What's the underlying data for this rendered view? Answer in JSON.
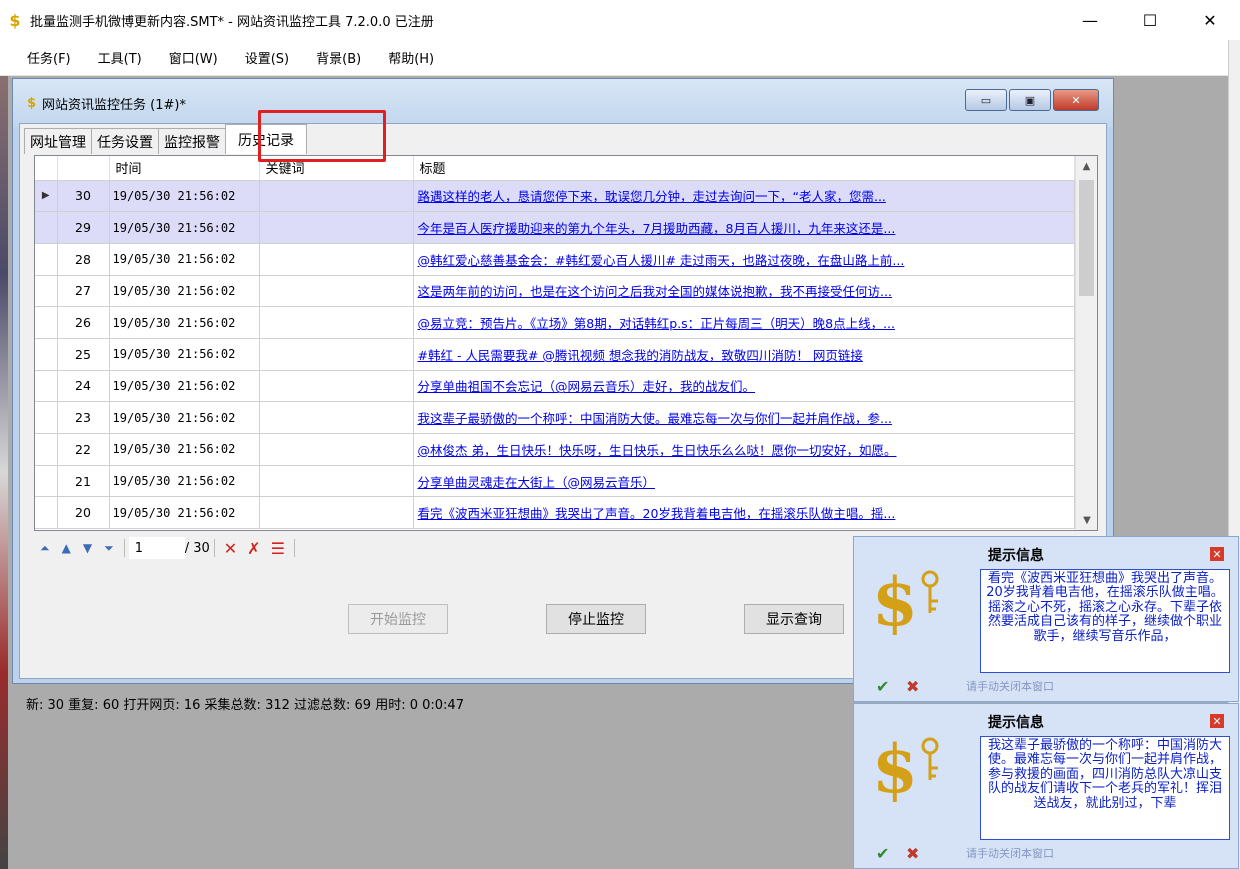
{
  "window": {
    "title": "批量监测手机微博更新内容.SMT* - 网站资讯监控工具 7.2.0.0 已注册",
    "min": "—",
    "max": "☐",
    "close": "✕"
  },
  "menu": [
    "任务(F)",
    "工具(T)",
    "窗口(W)",
    "设置(S)",
    "背景(B)",
    "帮助(H)"
  ],
  "child": {
    "title": "网站资讯监控任务 (1#)*",
    "tabs": [
      "网址管理",
      "任务设置",
      "监控报警",
      "历史记录"
    ],
    "active_tab": "历史记录"
  },
  "grid": {
    "columns": [
      "时间",
      "关键词",
      "标题"
    ],
    "rows": [
      {
        "no": "30",
        "time": "19/05/30 21:56:02",
        "keyword": "",
        "title": "路遇这样的老人，恳请您停下来，耽误您几分钟，走过去询问一下，“老人家，您需..."
      },
      {
        "no": "29",
        "time": "19/05/30 21:56:02",
        "keyword": "",
        "title": "今年是百人医疗援助迎来的第九个年头，7月援助西藏，8月百人援川，九年来这还是..."
      },
      {
        "no": "28",
        "time": "19/05/30 21:56:02",
        "keyword": "",
        "title": "@韩红爱心慈善基金会：#韩红爱心百人援川# 走过雨天，也路过夜晚，在盘山路上前..."
      },
      {
        "no": "27",
        "time": "19/05/30 21:56:02",
        "keyword": "",
        "title": "这是两年前的访问，也是在这个访问之后我对全国的媒体说抱歉，我不再接受任何访..."
      },
      {
        "no": "26",
        "time": "19/05/30 21:56:02",
        "keyword": "",
        "title": "@易立竞：预告片。《立场》第8期，对话韩红p.s：正片每周三（明天）晚8点上线，..."
      },
      {
        "no": "25",
        "time": "19/05/30 21:56:02",
        "keyword": "",
        "title": "#韩红 - 人民需要我# @腾讯视频 想念我的消防战友，致敬四川消防！ 网页链接"
      },
      {
        "no": "24",
        "time": "19/05/30 21:56:02",
        "keyword": "",
        "title": "分享单曲祖国不会忘记（@网易云音乐）走好，我的战友们。"
      },
      {
        "no": "23",
        "time": "19/05/30 21:56:02",
        "keyword": "",
        "title": "我这辈子最骄傲的一个称呼：中国消防大使。最难忘每一次与你们一起并肩作战，参..."
      },
      {
        "no": "22",
        "time": "19/05/30 21:56:02",
        "keyword": "",
        "title": "@林俊杰 弟，生日快乐！快乐呀，生日快乐，生日快乐么么哒！愿你一切安好，如愿。"
      },
      {
        "no": "21",
        "time": "19/05/30 21:56:02",
        "keyword": "",
        "title": "分享单曲灵魂走在大街上（@网易云音乐）"
      },
      {
        "no": "20",
        "time": "19/05/30 21:56:02",
        "keyword": "",
        "title": "看完《波西米亚狂想曲》我哭出了声音。20岁我背着电吉他，在摇滚乐队做主唱。摇..."
      }
    ]
  },
  "navigator": {
    "page": "1",
    "of": "/ 30"
  },
  "buttons": {
    "start": "开始监控",
    "stop": "停止监控",
    "query": "显示查询"
  },
  "status": "新: 30  重复: 60  打开网页: 16  采集总数: 312  过滤总数: 69  用时: 0 0:0:47",
  "popups": [
    {
      "title": "提示信息",
      "text": "看完《波西米亚狂想曲》我哭出了声音。20岁我背着电吉他，在摇滚乐队做主唱。摇滚之心不死，摇滚之心永存。下辈子依然要活成自己该有的样子，继续做个职业歌手，继续写音乐作品，",
      "hint": "请手动关闭本窗口"
    },
    {
      "title": "提示信息",
      "text": "我这辈子最骄傲的一个称呼：中国消防大使。最难忘每一次与你们一起并肩作战，参与救援的画面，四川消防总队大凉山支队的战友们请收下一个老兵的军礼！挥泪送战友，就此别过，下辈",
      "hint": "请手动关闭本窗口"
    }
  ]
}
